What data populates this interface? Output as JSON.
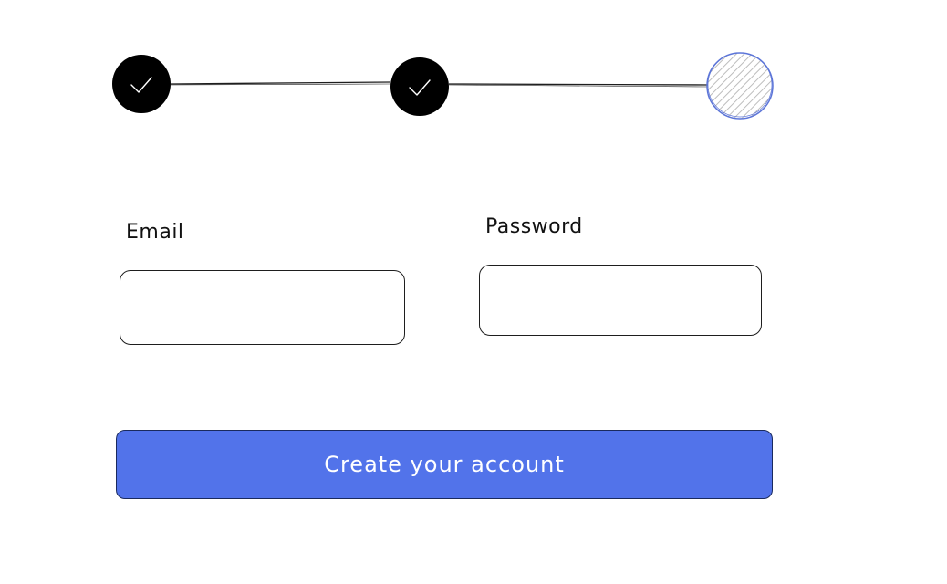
{
  "stepper": {
    "steps": [
      {
        "status": "complete",
        "icon": "check-icon"
      },
      {
        "status": "complete",
        "icon": "check-icon"
      },
      {
        "status": "current",
        "icon": "hatched-circle"
      }
    ],
    "colors": {
      "complete_fill": "#000000",
      "current_stroke": "#5c75d8",
      "current_hatch": "#bdbdbd",
      "connector": "#1e1e1e"
    }
  },
  "form": {
    "email_label": "Email",
    "email_value": "",
    "email_placeholder": "",
    "password_label": "Password",
    "password_value": "",
    "password_placeholder": ""
  },
  "submit": {
    "label": "Create your account",
    "color": "#5273ea"
  }
}
